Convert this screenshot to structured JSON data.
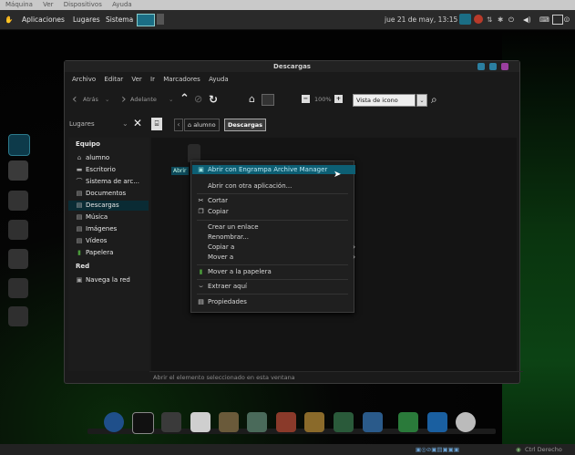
{
  "vm_menu": [
    "Máquina",
    "Ver",
    "Dispositivos",
    "Ayuda"
  ],
  "top_panel": {
    "menus": [
      "Aplicaciones",
      "Lugares",
      "Sistema"
    ],
    "clock": "jue 21 de may, 13:15"
  },
  "window": {
    "title": "Descargas",
    "menubar": [
      "Archivo",
      "Editar",
      "Ver",
      "Ir",
      "Marcadores",
      "Ayuda"
    ],
    "toolbar": {
      "back_label": "Atrás",
      "forward_label": "Adelante",
      "zoom_level": "100%",
      "view_mode": "Vista de icono"
    },
    "location": {
      "places_label": "Lugares",
      "crumbs": [
        "alumno",
        "Descargas"
      ]
    },
    "sidebar": {
      "sections": [
        {
          "title": "Equipo",
          "items": [
            {
              "icon": "home-icon",
              "label": "alumno"
            },
            {
              "icon": "desktop-icon",
              "label": "Escritorio"
            },
            {
              "icon": "drive-icon",
              "label": "Sistema de arc..."
            },
            {
              "icon": "folder-icon",
              "label": "Documentos"
            },
            {
              "icon": "download-folder-icon",
              "label": "Descargas",
              "selected": true
            },
            {
              "icon": "music-folder-icon",
              "label": "Música"
            },
            {
              "icon": "pictures-folder-icon",
              "label": "Imágenes"
            },
            {
              "icon": "videos-folder-icon",
              "label": "Vídeos"
            },
            {
              "icon": "trash-icon",
              "label": "Papelera"
            }
          ]
        },
        {
          "title": "Red",
          "items": [
            {
              "icon": "network-icon",
              "label": "Navega la red"
            }
          ]
        }
      ]
    },
    "file": {
      "label": "Abrir"
    },
    "status": "Abrir el elemento seleccionado en esta ventana"
  },
  "context_menu": [
    {
      "icon": "archive-manager-icon",
      "label": "Abrir con Engrampa Archive Manager",
      "highlighted": true
    },
    {
      "label": "Abrir con otra aplicación..."
    },
    {
      "separator": true
    },
    {
      "icon": "cut-icon",
      "label": "Cortar"
    },
    {
      "icon": "copy-icon",
      "label": "Copiar"
    },
    {
      "separator": true
    },
    {
      "label": "Crear un enlace"
    },
    {
      "label": "Renombrar..."
    },
    {
      "label": "Copiar a",
      "submenu": true
    },
    {
      "label": "Mover a",
      "submenu": true
    },
    {
      "separator": true
    },
    {
      "icon": "trash-icon",
      "label": "Mover a la papelera"
    },
    {
      "separator": true
    },
    {
      "icon": "extract-icon",
      "label": "Extraer aquí"
    },
    {
      "separator": true
    },
    {
      "icon": "properties-icon",
      "label": "Propiedades"
    }
  ],
  "bottom_panel": {
    "host_key": "Ctrl Derecho"
  },
  "colors": {
    "highlight": "#0d5f74",
    "selection": "#0a2b34",
    "panel": "#2a2a2a"
  }
}
